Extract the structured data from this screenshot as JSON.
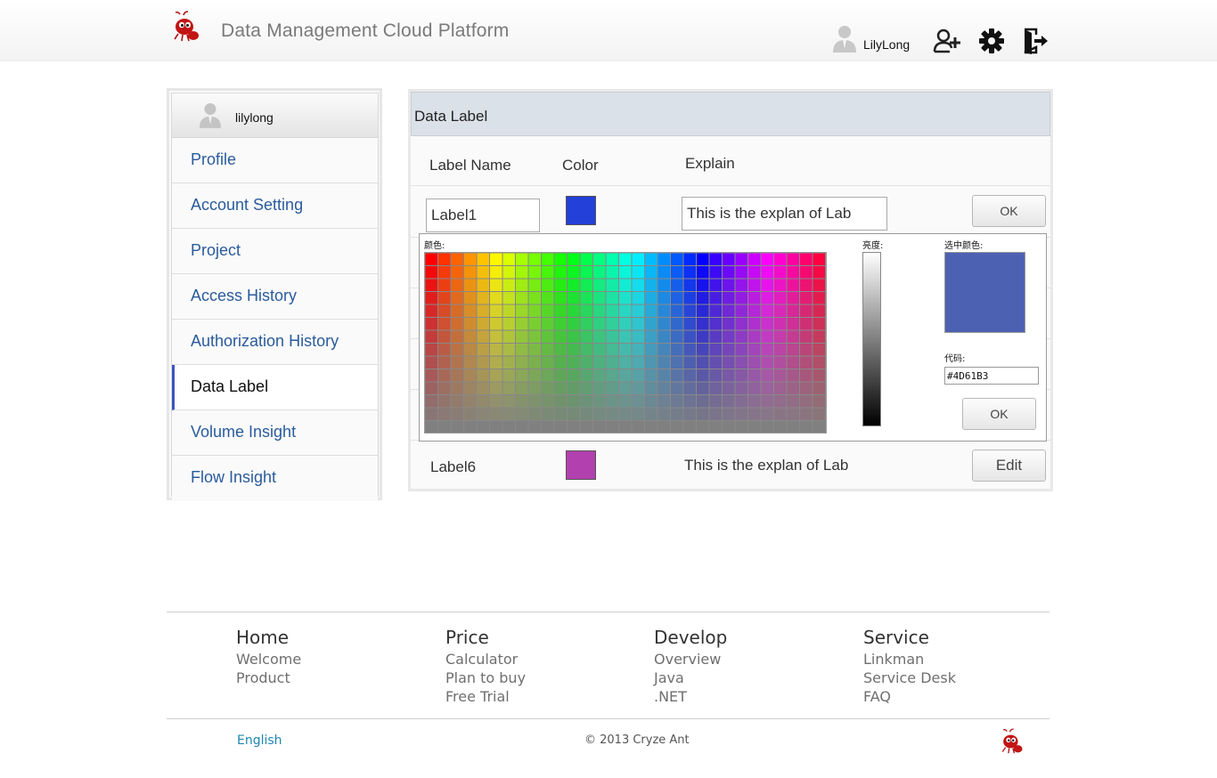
{
  "header": {
    "title": "Data Management Cloud Platform",
    "user_name": "LilyLong",
    "icons": [
      "ant-logo-icon",
      "user-avatar-icon",
      "add-user-icon",
      "gear-icon",
      "logout-icon"
    ]
  },
  "sidebar": {
    "user_name": "lilylong",
    "items": [
      {
        "label": "Profile"
      },
      {
        "label": "Account Setting"
      },
      {
        "label": "Project"
      },
      {
        "label": "Access History"
      },
      {
        "label": "Authorization History"
      },
      {
        "label": "Data Label",
        "active": true
      },
      {
        "label": "Volume Insight"
      },
      {
        "label": "Flow Insight"
      }
    ]
  },
  "panel": {
    "title": "Data Label",
    "columns": [
      "Label Name",
      "Color",
      "Explain"
    ],
    "rows": [
      {
        "name": "Label1",
        "color": "#2340d8",
        "explain": "This is the explan of Lab",
        "action": "OK",
        "editing": true
      },
      {
        "name": "Label6",
        "color": "#b240ae",
        "explain": "This is the explan of Lab",
        "action": "Edit",
        "editing": false
      }
    ]
  },
  "color_picker": {
    "color_label": "颜色:",
    "brightness_label": "亮度:",
    "selected_label": "选中颜色:",
    "code_label": "代码:",
    "hex_value": "#4D61B3",
    "selected_color": "#4d61b3",
    "ok_label": "OK"
  },
  "footer": {
    "columns": [
      {
        "head": "Home",
        "links": [
          "Welcome",
          "Product"
        ]
      },
      {
        "head": "Price",
        "links": [
          "Calculator",
          "Plan to buy",
          "Free Trial"
        ]
      },
      {
        "head": "Develop",
        "links": [
          "Overview",
          "Java",
          ".NET"
        ]
      },
      {
        "head": "Service",
        "links": [
          "Linkman",
          "Service Desk",
          "FAQ"
        ]
      }
    ],
    "language": "English",
    "copyright": "© 2013 Cryze Ant"
  }
}
